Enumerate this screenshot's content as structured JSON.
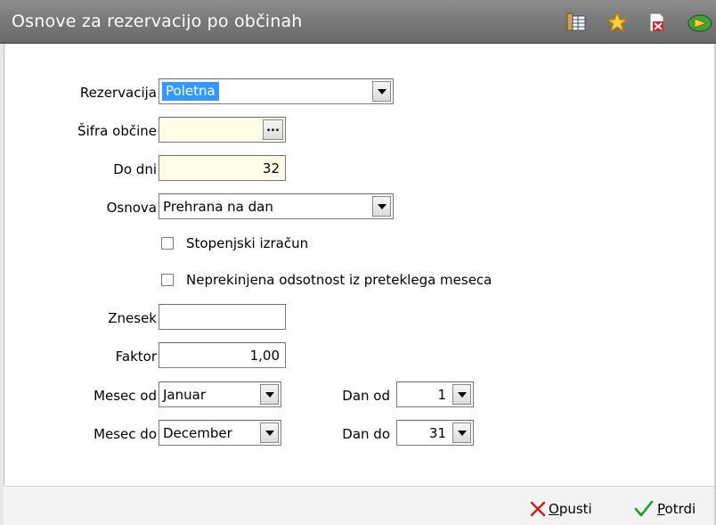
{
  "window": {
    "title": "Osnove za rezervacijo po občinah"
  },
  "titlebar_icons": [
    "table-settings-icon",
    "star-icon",
    "pdf-close-icon",
    "green-arrow-icon"
  ],
  "form": {
    "rezervacija": {
      "label": "Rezervacija",
      "value": "Poletna"
    },
    "sifra_obcine": {
      "label": "Šifra občine",
      "value": "",
      "button": "..."
    },
    "do_dni": {
      "label": "Do dni",
      "value": "32"
    },
    "osnova": {
      "label": "Osnova",
      "value": "Prehrana na dan"
    },
    "stopenjski": {
      "label": "Stopenjski izračun",
      "checked": false
    },
    "neprekinjena": {
      "label": "Neprekinjena odsotnost iz preteklega meseca",
      "checked": false
    },
    "znesek": {
      "label": "Znesek",
      "value": ""
    },
    "faktor": {
      "label": "Faktor",
      "value": "1,00"
    },
    "mesec_od": {
      "label": "Mesec od",
      "value": "Januar"
    },
    "mesec_do": {
      "label": "Mesec do",
      "value": "December"
    },
    "dan_od": {
      "label": "Dan od",
      "value": "1"
    },
    "dan_do": {
      "label": "Dan do",
      "value": "31"
    }
  },
  "footer": {
    "opusti": {
      "label": "Opusti",
      "accent": "#d11a1a"
    },
    "potrdi": {
      "label": "Potrdi",
      "accent": "#1f9e1f"
    }
  }
}
